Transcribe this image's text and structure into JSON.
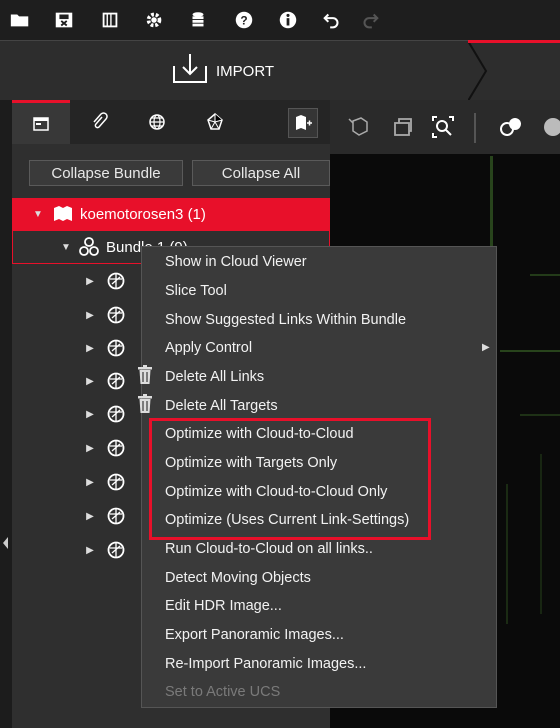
{
  "toolbar": {
    "icons": [
      "open-folder-icon",
      "save-icon",
      "project-icon",
      "settings-gear-icon",
      "database-icon",
      "help-icon",
      "info-icon",
      "undo-icon",
      "redo-icon"
    ]
  },
  "workflow": {
    "import_label": "IMPORT"
  },
  "panel": {
    "tabs": [
      "explorer-tab-icon",
      "attachments-tab-icon",
      "web-tab-icon",
      "model-tab-icon"
    ],
    "collapse_bundle": "Collapse Bundle",
    "collapse_all": "Collapse All"
  },
  "tree": {
    "project": "koemotorosen3 (1)",
    "bundle": "Bundle 1 (9)"
  },
  "context_menu": {
    "items": [
      "Show in Cloud Viewer",
      "Slice Tool",
      "Show Suggested Links Within Bundle",
      "Apply Control",
      "Delete All Links",
      "Delete All Targets",
      "Optimize with Cloud-to-Cloud",
      "Optimize with Targets Only",
      "Optimize with Cloud-to-Cloud Only",
      "Optimize (Uses Current Link-Settings)",
      "Run Cloud-to-Cloud on all links..",
      "Detect Moving Objects",
      "Edit HDR Image...",
      "Export Panoramic Images...",
      "Re-Import Panoramic Images...",
      "Set to Active UCS"
    ]
  },
  "colors": {
    "accent": "#e8102a",
    "menu_bg": "#3a3a3a",
    "panel_bg": "#2f2f2f"
  }
}
